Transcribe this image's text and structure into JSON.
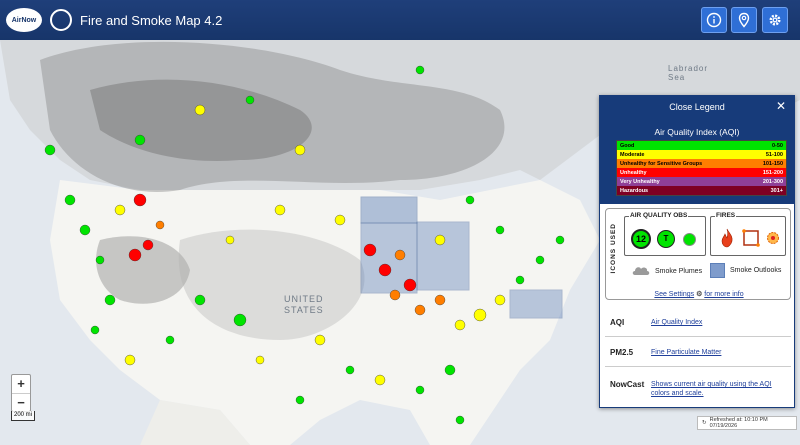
{
  "app": {
    "logo_text": "AirNow",
    "title": "Fire and Smoke Map 4.2"
  },
  "header_buttons": [
    {
      "name": "info-icon"
    },
    {
      "name": "location-pin-icon"
    },
    {
      "name": "gear-icon"
    }
  ],
  "map": {
    "labels": {
      "labrador_sea": "Labrador\nSea",
      "united_states": "UNITED\nSTATES"
    },
    "zoom_in": "+",
    "zoom_out": "−",
    "scale": "200 mi",
    "refreshed": "Refreshed at: 10:10 PM 07/19/2026"
  },
  "legend": {
    "close_label": "Close Legend",
    "close_x": "✕",
    "aqi_title": "Air Quality Index (AQI)",
    "aqi_levels": [
      {
        "label": "Good",
        "range": "0-50",
        "color": "#00e400",
        "text": "#000000"
      },
      {
        "label": "Moderate",
        "range": "51-100",
        "color": "#ffff00",
        "text": "#000000"
      },
      {
        "label": "Unhealthy for Sensitive Groups",
        "range": "101-150",
        "color": "#ff7e00",
        "text": "#000000"
      },
      {
        "label": "Unhealthy",
        "range": "151-200",
        "color": "#ff0000",
        "text": "#ffffff"
      },
      {
        "label": "Very Unhealthy",
        "range": "201-300",
        "color": "#8f3f97",
        "text": "#ffffff"
      },
      {
        "label": "Hazardous",
        "range": "301+",
        "color": "#7e0023",
        "text": "#ffffff"
      }
    ],
    "icons_used": "ICONS USED",
    "aq_obs_label": "AIR QUALITY OBS",
    "aq_obs_monitor": "12",
    "aq_obs_temp": "T",
    "fires_label": "FIRES",
    "smoke_plumes": "Smoke Plumes",
    "smoke_outlooks": "Smoke Outlooks",
    "see_settings": "See Settings",
    "for_more_info": "for more info",
    "terms": [
      {
        "key": "AQI",
        "value": "Air Quality Index"
      },
      {
        "key": "PM2.5",
        "value": "Fine Particulate Matter"
      },
      {
        "key": "NowCast",
        "value": "Shows current air quality using the AQI colors and scale."
      }
    ]
  }
}
